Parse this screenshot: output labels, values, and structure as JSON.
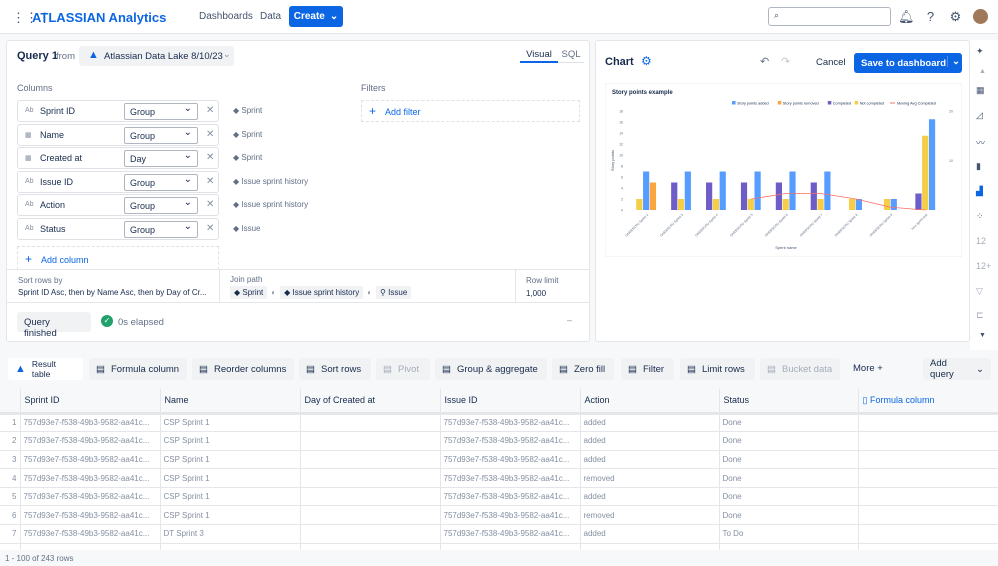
{
  "nav": {
    "logo": "ATLASSIAN Analytics",
    "links": [
      "Dashboards",
      "Data"
    ],
    "create": "Create",
    "search_placeholder": ""
  },
  "query": {
    "title": "Query 1",
    "from": "from",
    "source": "Atlassian Data Lake 8/10/23",
    "tabs": [
      "Visual",
      "SQL"
    ],
    "active_tab": "Visual",
    "columns_label": "Columns",
    "filters_label": "Filters",
    "add_filter": "Add filter",
    "add_column": "Add column",
    "columns": [
      {
        "type": "Ab",
        "name": "Sprint ID",
        "agg": "Group",
        "source": "Sprint"
      },
      {
        "type": "calendar",
        "name": "Name",
        "agg": "Group",
        "source": "Sprint"
      },
      {
        "type": "calendar",
        "name": "Created at",
        "agg": "Day",
        "source": "Sprint"
      },
      {
        "type": "Ab",
        "name": "Issue ID",
        "agg": "Group",
        "source": "Issue sprint history"
      },
      {
        "type": "Ab",
        "name": "Action",
        "agg": "Group",
        "source": "Issue sprint history"
      },
      {
        "type": "Ab",
        "name": "Status",
        "agg": "Group",
        "source": "Issue"
      }
    ],
    "sort_label": "Sort rows by",
    "sort_text": "Sprint ID Asc, then by Name Asc, then by Day of Cr...",
    "join_label": "Join path",
    "join": [
      "Sprint",
      "Issue sprint history",
      "Issue"
    ],
    "row_limit_label": "Row limit",
    "row_limit": "1,000",
    "status": "Query finished",
    "elapsed": "0s elapsed"
  },
  "chart_panel": {
    "title": "Chart",
    "cancel": "Cancel",
    "save": "Save to dashboard"
  },
  "chart_data": {
    "type": "bar",
    "title": "Story points example",
    "xlabel": "Sprint name",
    "ylabel": "Story points",
    "ylim": [
      0,
      18
    ],
    "y2ticks": [
      10,
      20
    ],
    "y2lim": [
      0,
      20
    ],
    "yticks": [
      0,
      2,
      4,
      6,
      8,
      10,
      12,
      14,
      16,
      18
    ],
    "legend": "top-right",
    "categories": [
      "ONEBSCRU Sprint 2",
      "ONEBSCRU Sprint 3",
      "ONEBSCRU Sprint 4",
      "ONEBSCRU Sprint 5",
      "ONEBSCRU Sprint 6",
      "ONEBSCRU Sprint 7",
      "ONEBSCRU Sprint 8",
      "ONEBSCRU Sprint 9",
      "new sprint test"
    ],
    "series": [
      {
        "name": "Story points added",
        "color": "#579dff",
        "values": [
          7,
          7,
          7,
          7,
          7,
          7,
          2,
          2,
          16.5
        ]
      },
      {
        "name": "Story points removed",
        "color": "#faa53d",
        "values": [
          5,
          0,
          0,
          0,
          0,
          0,
          0,
          0,
          0
        ]
      },
      {
        "name": "Completed",
        "color": "#6e5dc6",
        "values": [
          0,
          5,
          5,
          5,
          5,
          5,
          0,
          0,
          3
        ]
      },
      {
        "name": "Not completed",
        "color": "#f5cd47",
        "values": [
          2,
          2,
          2,
          2,
          2,
          2,
          2,
          2,
          13.5
        ]
      },
      {
        "name": "Moving Avg Completed",
        "type": "line",
        "color": "#f87168",
        "values": [
          null,
          null,
          null,
          2,
          3,
          3,
          2,
          0.5,
          0
        ]
      }
    ]
  },
  "toolbar": {
    "items": [
      {
        "label": "Result table",
        "icon": "atlassian-icon",
        "disabled": false
      },
      {
        "label": "Formula column",
        "icon": "formula-icon",
        "disabled": false
      },
      {
        "label": "Reorder columns",
        "icon": "reorder-icon",
        "disabled": false
      },
      {
        "label": "Sort rows",
        "icon": "sort-icon",
        "disabled": false
      },
      {
        "label": "Pivot",
        "icon": "pivot-icon",
        "disabled": true
      },
      {
        "label": "Group & aggregate",
        "icon": "group-icon",
        "disabled": false
      },
      {
        "label": "Zero fill",
        "icon": "zero-icon",
        "disabled": false
      },
      {
        "label": "Filter",
        "icon": "filter-icon",
        "disabled": false
      },
      {
        "label": "Limit rows",
        "icon": "limit-icon",
        "disabled": false
      },
      {
        "label": "Bucket data",
        "icon": "bucket-icon",
        "disabled": true
      }
    ],
    "more": "More",
    "add_query": "Add query"
  },
  "table": {
    "headers": [
      "Sprint ID",
      "Name",
      "Day of Created at",
      "Issue ID",
      "Action",
      "Status",
      "Formula column"
    ],
    "rows": [
      [
        "1",
        "757d93e7-f538-49b3-9582-aa41c...",
        "CSP Sprint 1",
        "",
        "757d93e7-f538-49b3-9582-aa41c...",
        "added",
        "Done"
      ],
      [
        "2",
        "757d93e7-f538-49b3-9582-aa41c...",
        "CSP Sprint 1",
        "",
        "757d93e7-f538-49b3-9582-aa41c...",
        "added",
        "Done"
      ],
      [
        "3",
        "757d93e7-f538-49b3-9582-aa41c...",
        "CSP Sprint 1",
        "",
        "757d93e7-f538-49b3-9582-aa41c...",
        "added",
        "Done"
      ],
      [
        "4",
        "757d93e7-f538-49b3-9582-aa41c...",
        "CSP Sprint 1",
        "",
        "757d93e7-f538-49b3-9582-aa41c...",
        "removed",
        "Done"
      ],
      [
        "5",
        "757d93e7-f538-49b3-9582-aa41c...",
        "CSP Sprint 1",
        "",
        "757d93e7-f538-49b3-9582-aa41c...",
        "added",
        "Done"
      ],
      [
        "6",
        "757d93e7-f538-49b3-9582-aa41c...",
        "CSP Sprint 1",
        "",
        "757d93e7-f538-49b3-9582-aa41c...",
        "removed",
        "Done"
      ],
      [
        "7",
        "757d93e7-f538-49b3-9582-aa41c...",
        "DT Sprint 3",
        "",
        "757d93e7-f538-49b3-9582-aa41c...",
        "added",
        "To Do"
      ]
    ],
    "footer": "1 - 100 of 243 rows"
  },
  "sidebar_icons": [
    "magic-icon",
    "table-icon",
    "area-icon",
    "line-icon",
    "bar-icon",
    "combo-icon",
    "scatter-icon",
    "number-icon",
    "number-trend-icon",
    "funnel-icon",
    "bullet-icon"
  ]
}
